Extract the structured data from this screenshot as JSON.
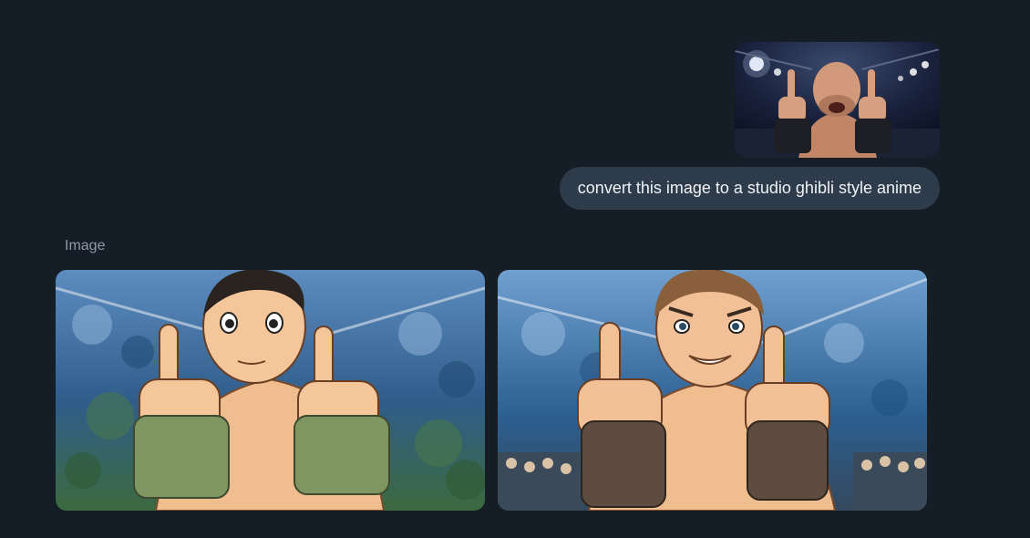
{
  "conversation": {
    "user_message": {
      "attachment_icon": "photo-thumbnail",
      "text": "convert this image to a studio ghibli style anime"
    },
    "response": {
      "label": "Image",
      "images": [
        {
          "icon": "generated-image-1"
        },
        {
          "icon": "generated-image-2"
        }
      ]
    }
  },
  "colors": {
    "background": "#151d27",
    "user_bubble": "#2e3b4a",
    "bubble_text": "#eef2f6",
    "label_text": "#8f9aa6"
  }
}
